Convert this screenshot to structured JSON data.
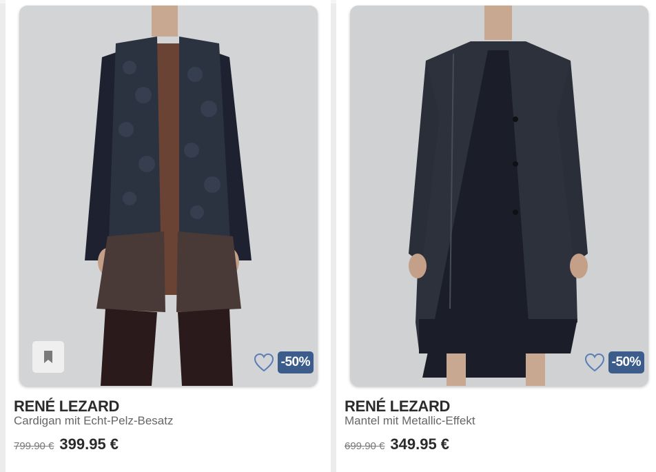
{
  "products": [
    {
      "brand": "RENÉ LEZARD",
      "name": "Cardigan mit Echt-Pelz-Besatz",
      "old_price": "799.90 €",
      "new_price": "399.95 €",
      "discount": "-50%"
    },
    {
      "brand": "RENÉ LEZARD",
      "name": "Mantel mit Metallic-Effekt",
      "old_price": "699.90 €",
      "new_price": "349.95 €",
      "discount": "-50%"
    }
  ],
  "icons": {
    "bookmark": "bookmark-icon",
    "wishlist": "heart-icon"
  },
  "colors": {
    "badge": "#3c5c8c",
    "heart_outline": "#5a7db8"
  }
}
